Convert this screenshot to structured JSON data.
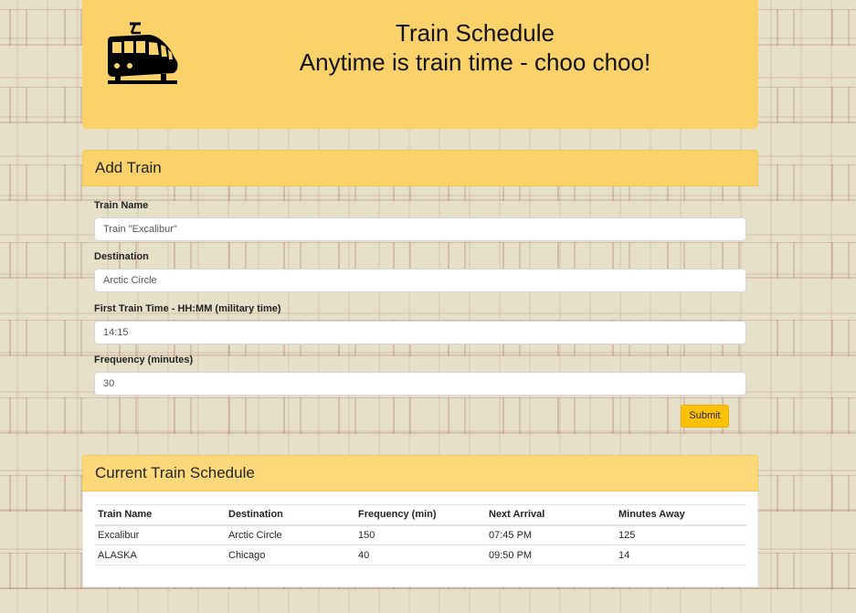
{
  "header": {
    "title": "Train Schedule",
    "subtitle": "Anytime is train time - choo choo!",
    "logo_icon": "train-icon"
  },
  "add_train": {
    "heading": "Add Train",
    "fields": [
      {
        "label": "Train Name",
        "placeholder": "Train \"Excalibur\"",
        "value": ""
      },
      {
        "label": "Destination",
        "placeholder": "Arctic Circle",
        "value": ""
      },
      {
        "label": "First Train Time - HH:MM (military time)",
        "placeholder": "14:15",
        "value": ""
      },
      {
        "label": "Frequency (minutes)",
        "placeholder": "30",
        "value": ""
      }
    ],
    "submit_label": "Submit"
  },
  "schedule": {
    "heading": "Current Train Schedule",
    "columns": [
      "Train Name",
      "Destination",
      "Frequency (min)",
      "Next Arrival",
      "Minutes Away"
    ],
    "rows": [
      [
        "Excalibur",
        "Arctic Circle",
        "150",
        "07:45 PM",
        "125"
      ],
      [
        "ALASKA",
        "Chicago",
        "40",
        "09:50 PM",
        "14"
      ]
    ]
  },
  "colors": {
    "accent": "#fbd16a",
    "button": "#ffc107",
    "background": "#e6e0c9"
  }
}
